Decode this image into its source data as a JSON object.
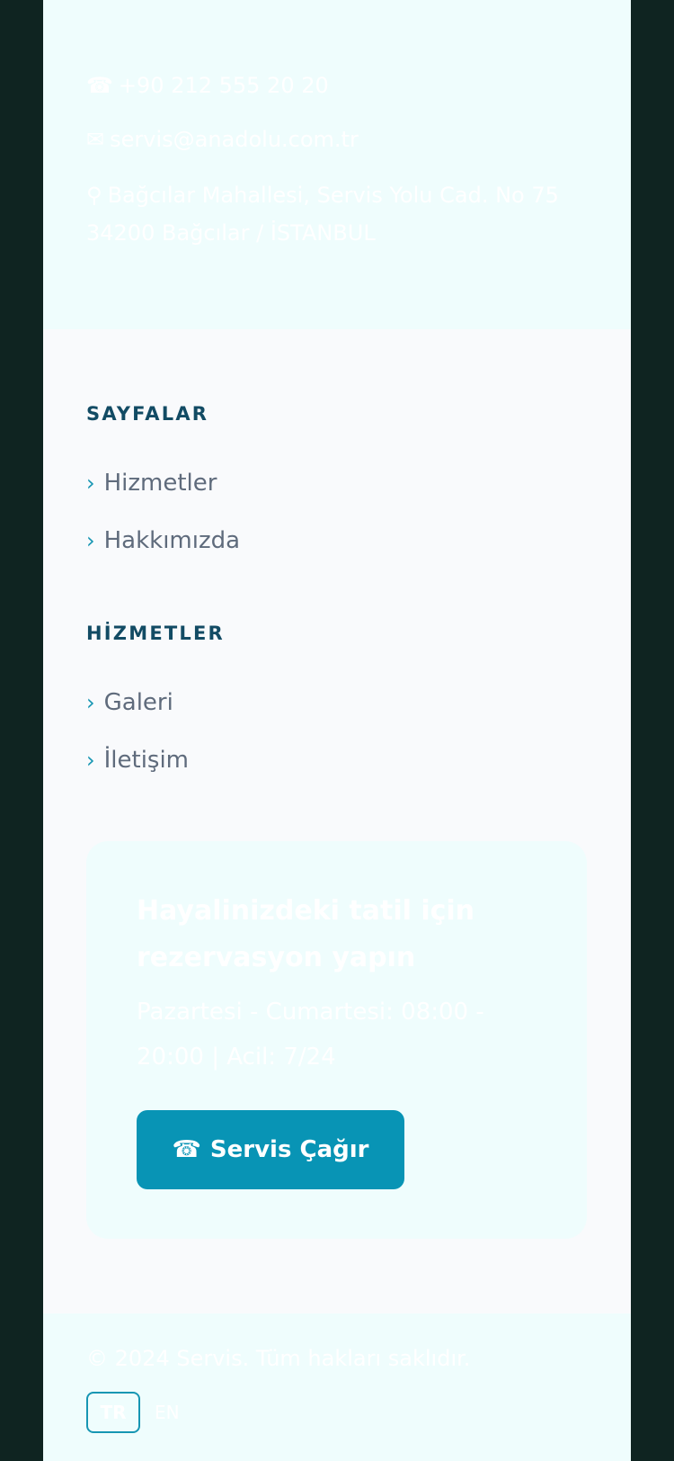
{
  "contact": {
    "phone": "+90 212 555 20 20",
    "phone_icon": "phone-icon",
    "email": "servis@anadolu.com.tr",
    "email_icon": "mail-icon",
    "address": "Bağcılar Mahallesi, Servis Yolu Cad. No 75 34200 Bağcılar / İSTANBUL",
    "address_icon": "location-icon"
  },
  "sections": {
    "pages": {
      "title": "SAYFALAR",
      "items": [
        "Hizmetler",
        "Hakkımızda"
      ]
    },
    "services": {
      "title": "HİZMETLER",
      "items": [
        "Galeri",
        "İletişim"
      ]
    }
  },
  "chevron": "›",
  "cta": {
    "title": "Hayalinizdeki tatil için rezervasyon yapın",
    "hours": "Pazartesi - Cumartesi: 08:00 - 20:00 | Acil: 7/24",
    "button_icon": "phone-icon",
    "button_label": "Servis Çağır"
  },
  "footer": {
    "copyright": "© 2024 Servis. Tüm hakları saklıdır.",
    "lang_tr": "TR",
    "lang_en": "EN"
  },
  "colors": {
    "accent": "#0894b5",
    "heading": "#124b64",
    "text": "#5f6b7c",
    "outer_bg": "#0f2421"
  }
}
